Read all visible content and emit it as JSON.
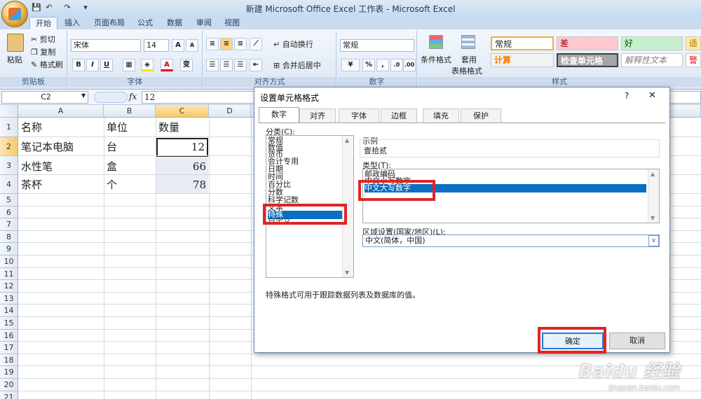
{
  "app": {
    "title": "新建 Microsoft Office Excel 工作表 - Microsoft Excel",
    "qat_symbols": [
      "💾",
      "↶",
      "↷",
      "▾"
    ]
  },
  "ribbon_tabs": [
    "开始",
    "插入",
    "页面布局",
    "公式",
    "数据",
    "审阅",
    "视图"
  ],
  "clipboard": {
    "paste": "粘贴",
    "cut": "剪切",
    "copy": "复制",
    "format_painter": "格式刷",
    "label": "剪贴板"
  },
  "font": {
    "name": "宋体",
    "size": "14",
    "grow": "A",
    "shrink": "A",
    "bold": "B",
    "italic": "I",
    "underline": "U",
    "label": "字体",
    "phonetic": "变"
  },
  "alignment": {
    "wrap": "自动换行",
    "merge": "合并后居中",
    "label": "对齐方式"
  },
  "number": {
    "format": "常规",
    "percent": "%",
    "comma": ",",
    "label": "数字"
  },
  "styles": {
    "conditional": "条件格式",
    "table_format_1": "套用",
    "table_format_2": "表格格式",
    "cells": [
      "常规",
      "差",
      "好",
      "适中",
      "计算",
      "检查单元格",
      "解释性文本",
      "警告"
    ],
    "label": "样式"
  },
  "formula_bar": {
    "name_box": "C2",
    "fx": "fx",
    "value": "12"
  },
  "columns": [
    "A",
    "B",
    "C",
    "D"
  ],
  "rows": [
    "1",
    "2",
    "3",
    "4",
    "5",
    "6",
    "7",
    "8",
    "9",
    "10",
    "11",
    "12",
    "13",
    "14",
    "15",
    "16",
    "17",
    "18",
    "19",
    "20",
    "21"
  ],
  "sheet": {
    "a1": "名称",
    "b1": "单位",
    "c1": "数量",
    "a2": "笔记本电脑",
    "b2": "台",
    "c2": "12",
    "a3": "水性笔",
    "b3": "盒",
    "c3": "66",
    "a4": "茶杯",
    "b4": "个",
    "c4": "78"
  },
  "dialog": {
    "title": "设置单元格格式",
    "help": "?",
    "close": "✕",
    "tabs": [
      "数字",
      "对齐",
      "字体",
      "边框",
      "填充",
      "保护"
    ],
    "category_label": "分类(C):",
    "categories": [
      "常规",
      "数值",
      "货币",
      "会计专用",
      "日期",
      "时间",
      "百分比",
      "分数",
      "科学记数",
      "文本",
      "特殊",
      "自定义"
    ],
    "selected_category": "特殊",
    "sample_label": "示例",
    "sample_value": "壹拾贰",
    "type_label": "类型(T):",
    "types": [
      "邮政编码",
      "中文小写数字",
      "中文大写数字"
    ],
    "selected_type": "中文大写数字",
    "locale_label": "区域设置(国家/地区)(L):",
    "locale_value": "中文(简体，中国)",
    "description": "特殊格式可用于跟踪数据列表及数据库的值。",
    "ok": "确定",
    "cancel": "取消"
  },
  "watermark": {
    "brand": "Baidu 经验",
    "url": "jingyan.baidu.com"
  },
  "colors": {
    "accent": "#0a6fc2",
    "highlight": "#e02525",
    "selected_header": "#f8c868"
  }
}
